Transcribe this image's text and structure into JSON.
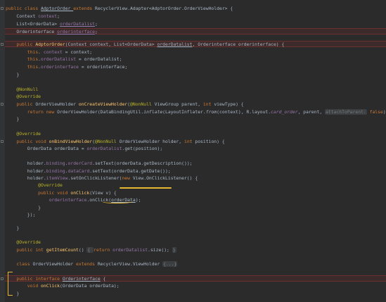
{
  "editor": {
    "lines": [
      {
        "t": 8,
        "segs": [
          [
            "kw",
            "public class "
          ],
          [
            "u",
            "AdptorOrder "
          ],
          [
            "kw",
            "extends "
          ],
          [
            "",
            "RecyclerView.Adapter<AdptorOrder.OrderViewHolder> {"
          ]
        ]
      },
      {
        "t": 19,
        "segs": [
          [
            "",
            "    Context "
          ],
          [
            "fld",
            "context"
          ],
          [
            "",
            ";"
          ]
        ]
      },
      {
        "t": 30,
        "segs": [
          [
            "",
            "    List<OrderData> "
          ],
          [
            "fld u",
            "orderDatalist"
          ],
          [
            "",
            ";"
          ]
        ]
      },
      {
        "t": 41,
        "segs": [
          [
            "",
            "    Orderinterface "
          ],
          [
            "fld u",
            "orderinterface"
          ],
          [
            "",
            ";"
          ]
        ]
      },
      {
        "t": 59,
        "segs": [
          [
            "kw",
            "    public "
          ],
          [
            "fn",
            "AdptorOrder"
          ],
          [
            "",
            "(Context context, List<OrderData> "
          ],
          [
            "u",
            "orderDatalist"
          ],
          [
            "",
            ", Orderinterface orderinterface) {"
          ]
        ]
      },
      {
        "t": 70,
        "segs": [
          [
            "kw",
            "        this"
          ],
          [
            "",
            ". "
          ],
          [
            "fld",
            "context"
          ],
          [
            "",
            " = context;"
          ]
        ]
      },
      {
        "t": 80,
        "segs": [
          [
            "kw",
            "        this"
          ],
          [
            "",
            "."
          ],
          [
            "fld",
            "orderDatalist"
          ],
          [
            "",
            " = orderDatalist;"
          ]
        ]
      },
      {
        "t": 91,
        "segs": [
          [
            "kw",
            "        this"
          ],
          [
            "",
            "."
          ],
          [
            "fld",
            "orderinterface"
          ],
          [
            "",
            " = orderinterface;"
          ]
        ]
      },
      {
        "t": 102,
        "segs": [
          [
            "",
            "    }"
          ]
        ]
      },
      {
        "t": 123,
        "segs": [
          [
            "ann",
            "    @NonNull"
          ]
        ]
      },
      {
        "t": 133,
        "segs": [
          [
            "ann",
            "    @Override"
          ]
        ]
      },
      {
        "t": 144,
        "segs": [
          [
            "kw",
            "    public "
          ],
          [
            "",
            "OrderViewHolder "
          ],
          [
            "fn",
            "onCreateViewHolder"
          ],
          [
            "",
            "("
          ],
          [
            "ann",
            "@NonNull "
          ],
          [
            "",
            "ViewGroup parent, "
          ],
          [
            "kw",
            "int "
          ],
          [
            "",
            "viewType) {"
          ]
        ]
      },
      {
        "t": 155,
        "segs": [
          [
            "kw",
            "        return new "
          ],
          [
            "",
            "OrderViewHolder(DataBindingUtil."
          ],
          [
            "it",
            "inflate"
          ],
          [
            "",
            "(LayoutInflater."
          ],
          [
            "it",
            "from"
          ],
          [
            "",
            "(context), R.layout."
          ],
          [
            "fld it",
            "card_order"
          ],
          [
            "",
            ", parent, "
          ],
          [
            "hint",
            "attachToParent:"
          ],
          [
            "kw",
            " false"
          ],
          [
            "",
            "));"
          ]
        ]
      },
      {
        "t": 165,
        "segs": [
          [
            "",
            "    }"
          ]
        ]
      },
      {
        "t": 186,
        "segs": [
          [
            "ann",
            "    @Override"
          ]
        ]
      },
      {
        "t": 197,
        "segs": [
          [
            "kw",
            "    public void "
          ],
          [
            "fn",
            "onBindViewHolder"
          ],
          [
            "",
            "("
          ],
          [
            "ann",
            "@NonNull "
          ],
          [
            "",
            "OrderViewHolder holder, "
          ],
          [
            "kw",
            "int "
          ],
          [
            "",
            "position) {"
          ]
        ]
      },
      {
        "t": 207,
        "segs": [
          [
            "",
            "        OrderData orderData = "
          ],
          [
            "fld",
            "orderDatalist"
          ],
          [
            "",
            ".get(position);"
          ]
        ]
      },
      {
        "t": 228,
        "segs": [
          [
            "",
            "        holder."
          ],
          [
            "fld",
            "binding"
          ],
          [
            "",
            "."
          ],
          [
            "fld",
            "orderCard"
          ],
          [
            "",
            ".setText(orderData.getDescription());"
          ]
        ]
      },
      {
        "t": 239,
        "segs": [
          [
            "",
            "        holder."
          ],
          [
            "fld",
            "binding"
          ],
          [
            "",
            "."
          ],
          [
            "fld",
            "dataCard"
          ],
          [
            "",
            ".setText(orderData.getDate());"
          ]
        ]
      },
      {
        "t": 249,
        "segs": [
          [
            "",
            "        holder."
          ],
          [
            "fld",
            "itemView"
          ],
          [
            "",
            ".setOnClickListener("
          ],
          [
            "kw",
            "new "
          ],
          [
            "",
            "View.OnClickListener() {"
          ]
        ]
      },
      {
        "t": 259,
        "segs": [
          [
            "ann",
            "            @Override"
          ]
        ]
      },
      {
        "t": 270,
        "segs": [
          [
            "kw",
            "            public void "
          ],
          [
            "fn",
            "onClick"
          ],
          [
            "",
            "(View v) {"
          ]
        ]
      },
      {
        "t": 280,
        "segs": [
          [
            "",
            "                "
          ],
          [
            "fld",
            "orderinterface"
          ],
          [
            "",
            ".onClick("
          ],
          [
            "u",
            "orderData"
          ],
          [
            "",
            ");"
          ]
        ]
      },
      {
        "t": 291,
        "segs": [
          [
            "",
            "            }"
          ]
        ]
      },
      {
        "t": 301,
        "segs": [
          [
            "",
            "        });"
          ]
        ]
      },
      {
        "t": 320,
        "segs": [
          [
            "",
            "    }"
          ]
        ]
      },
      {
        "t": 340,
        "segs": [
          [
            "ann",
            "    @Override"
          ]
        ]
      },
      {
        "t": 351,
        "segs": [
          [
            "kw",
            "    public int "
          ],
          [
            "fn",
            "getItemCount"
          ],
          [
            "",
            "() "
          ],
          [
            "fldbox",
            "{ "
          ],
          [
            "kw",
            "return "
          ],
          [
            "fld",
            "orderDatalist"
          ],
          [
            "",
            ".size(); "
          ],
          [
            "fldbox",
            "}"
          ]
        ]
      },
      {
        "t": 371,
        "segs": [
          [
            "kw",
            "    class "
          ],
          [
            "",
            "OrderViewHolder "
          ],
          [
            "kw",
            "extends "
          ],
          [
            "",
            "RecyclerView.ViewHolder "
          ],
          [
            "fldbox",
            "{...}"
          ]
        ]
      },
      {
        "t": 392,
        "segs": [
          [
            "kw",
            "    public interface "
          ],
          [
            "u",
            "Orderinterface"
          ],
          [
            "",
            " {"
          ]
        ]
      },
      {
        "t": 402,
        "segs": [
          [
            "kw",
            "        void "
          ],
          [
            "fn",
            "onClick"
          ],
          [
            "",
            "(OrderData orderData);"
          ]
        ]
      },
      {
        "t": 413,
        "segs": [
          [
            "",
            "    }"
          ]
        ]
      }
    ]
  },
  "colors": {
    "background": "#2b2b2b",
    "keyword": "#cc7832",
    "method": "#ffc66d",
    "field": "#9876aa",
    "annotation": "#bbb529",
    "highlight": "#e8b730"
  }
}
